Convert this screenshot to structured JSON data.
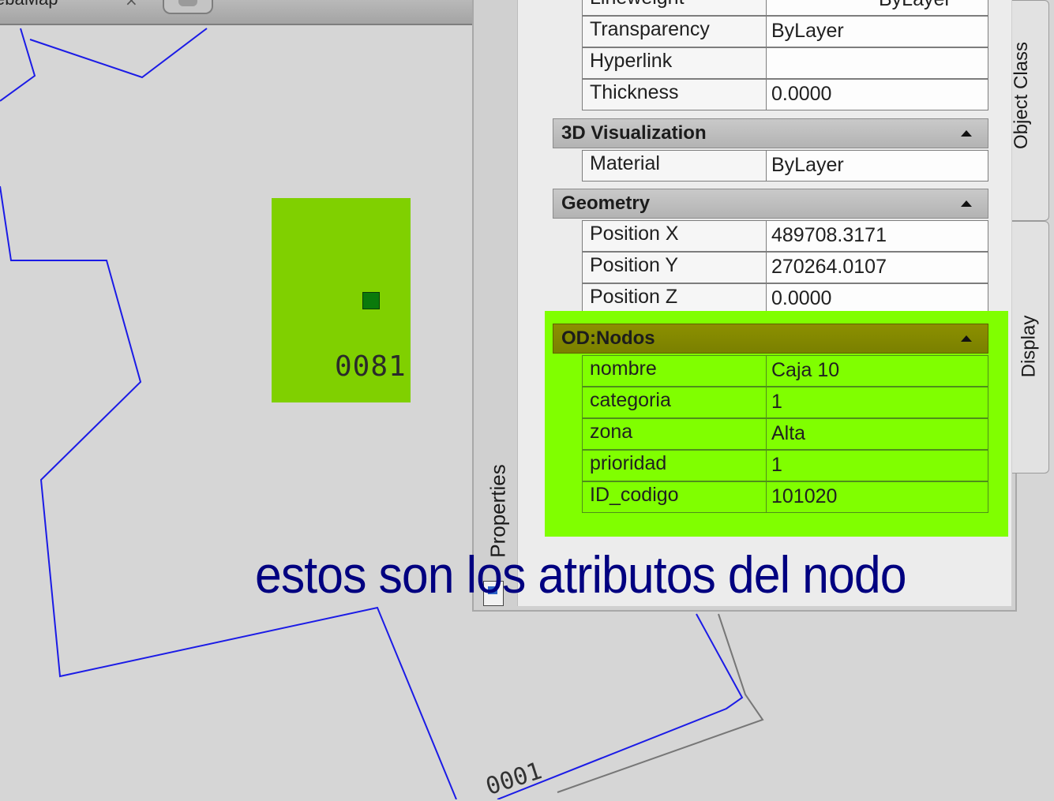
{
  "tab": {
    "label": "ebaMap",
    "close_glyph": "×"
  },
  "drawing": {
    "node_label": "0081",
    "bottom_label": "0001"
  },
  "palette": {
    "title": "Properties",
    "side_tabs": [
      "Object Class",
      "Display"
    ],
    "general_rows": [
      {
        "label": "Lineweight",
        "value": "ByLayer"
      },
      {
        "label": "Transparency",
        "value": "ByLayer"
      },
      {
        "label": "Hyperlink",
        "value": ""
      },
      {
        "label": "Thickness",
        "value": "0.0000"
      }
    ],
    "sections": {
      "visualization": {
        "title": "3D Visualization",
        "rows": [
          {
            "label": "Material",
            "value": "ByLayer"
          }
        ]
      },
      "geometry": {
        "title": "Geometry",
        "rows": [
          {
            "label": "Position X",
            "value": "489708.3171"
          },
          {
            "label": "Position Y",
            "value": "270264.0107"
          },
          {
            "label": "Position Z",
            "value": "0.0000"
          }
        ]
      },
      "od": {
        "title": "OD:Nodos",
        "rows": [
          {
            "label": "nombre",
            "value": "Caja 10"
          },
          {
            "label": "categoria",
            "value": "1"
          },
          {
            "label": "zona",
            "value": "Alta"
          },
          {
            "label": "prioridad",
            "value": "1"
          },
          {
            "label": "ID_codigo",
            "value": "101020"
          }
        ]
      }
    }
  },
  "annotation": "estos son los atributos del nodo",
  "colors": {
    "highlight": "#80ff00",
    "node_fill": "#80d000",
    "boundary_line": "#0000dd",
    "annotation_text": "#000080"
  }
}
